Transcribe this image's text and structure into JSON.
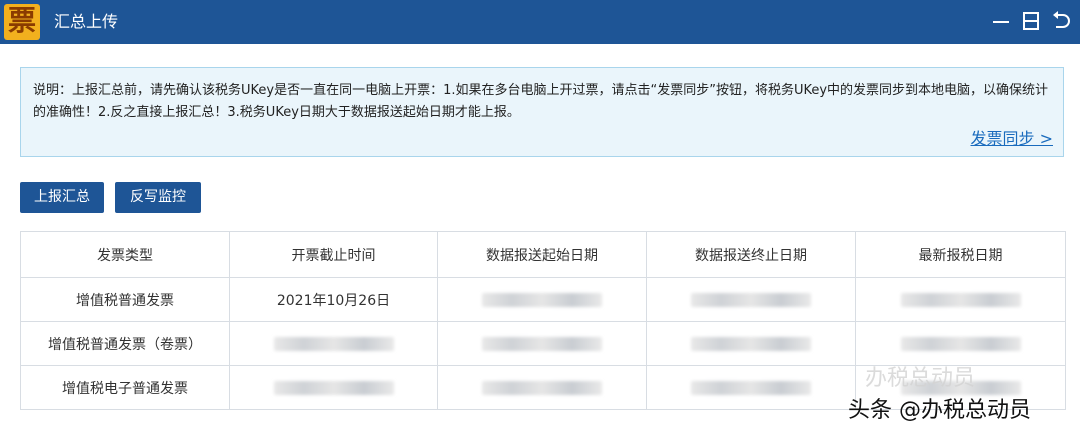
{
  "window": {
    "title": "汇总上传",
    "logo_char": "票",
    "controls": [
      "minimize-icon",
      "restore-icon",
      "back-icon"
    ]
  },
  "notice": {
    "text": "说明：上报汇总前，请先确认该税务UKey是否一直在同一电脑上开票：1.如果在多台电脑上开过票，请点击“发票同步”按钮，将税务UKey中的发票同步到本地电脑，以确保统计的准确性！2.反之直接上报汇总！3.税务UKey日期大于数据报送起始日期才能上报。",
    "link": "发票同步 >"
  },
  "buttons": {
    "report": "上报汇总",
    "monitor": "反写监控"
  },
  "table": {
    "headers": [
      "发票类型",
      "开票截止时间",
      "数据报送起始日期",
      "数据报送终止日期",
      "最新报税日期"
    ],
    "rows": [
      {
        "type": "增值税普通发票",
        "deadline": "2021年10月26日"
      },
      {
        "type": "增值税普通发票（卷票）",
        "deadline": ""
      },
      {
        "type": "增值税电子普通发票",
        "deadline": ""
      }
    ]
  },
  "watermark": {
    "faint": "办税总动员",
    "main": "头条 @办税总动员"
  }
}
